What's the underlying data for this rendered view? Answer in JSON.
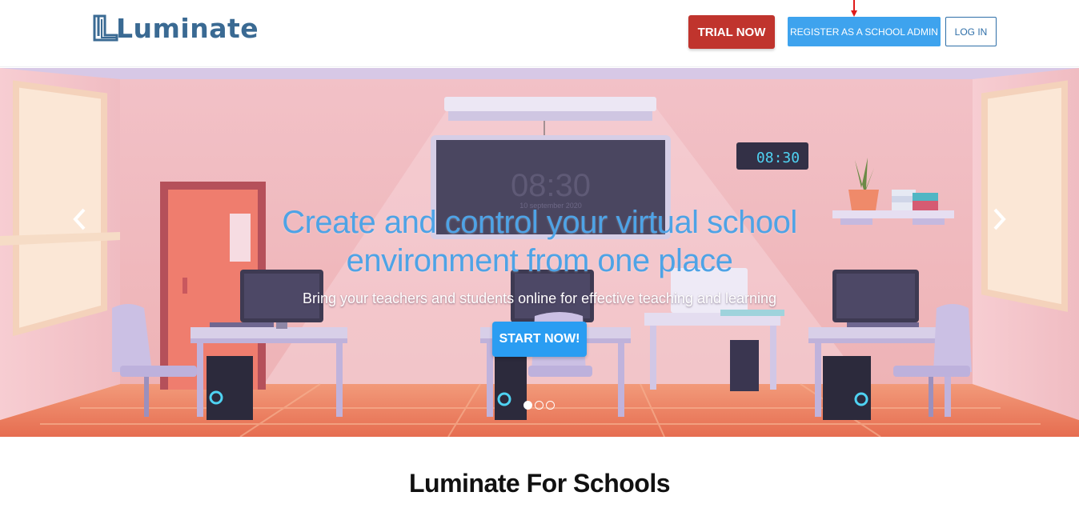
{
  "header": {
    "logo_text": "Luminate",
    "trial_label": "TRIAL NOW",
    "register_label": "REGISTER AS A SCHOOL ADMIN",
    "login_label": "LOG IN"
  },
  "hero": {
    "title": "Create and control your virtual school environment from one place",
    "subtitle": "Bring your teachers and students online for effective teaching and learning",
    "cta_label": "START NOW!",
    "clock_display": "08:30",
    "board_time": "08:30",
    "board_date": "10 september 2020",
    "slides": 3,
    "active_slide": 1
  },
  "section": {
    "title": "Luminate For Schools"
  },
  "colors": {
    "brand": "#3a6a93",
    "trial": "#c0342d",
    "register": "#3ea3ee",
    "cta": "#2a9df2",
    "title_blue": "#4ea3e6"
  },
  "icons": {
    "prev": "chevron-left-icon",
    "next": "chevron-right-icon",
    "annotation": "red-arrow-icon"
  }
}
